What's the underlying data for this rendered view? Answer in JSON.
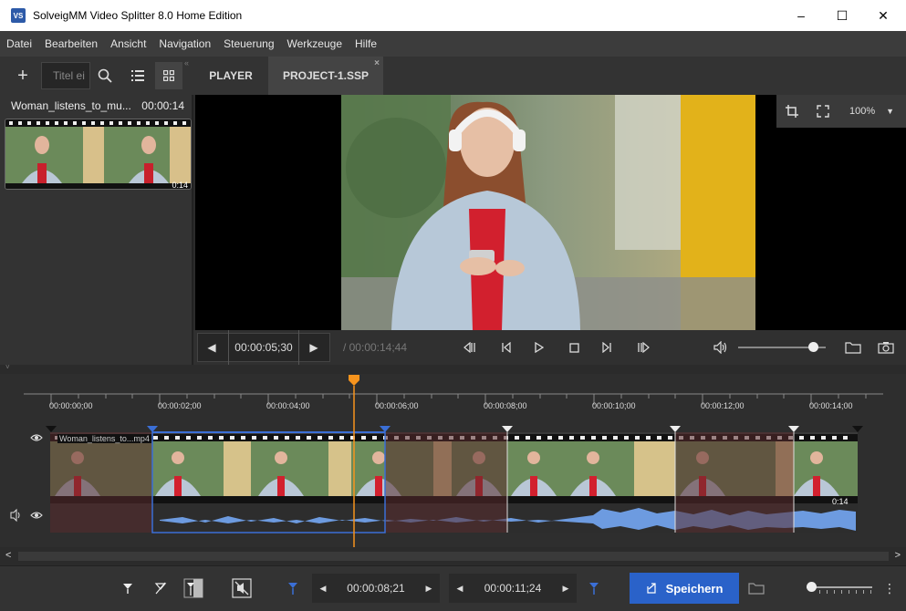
{
  "window": {
    "title": "SolveigMM Video Splitter 8.0 Home Edition",
    "icon_text": "VS",
    "minimize": "–",
    "maximize": "☐",
    "close": "✕"
  },
  "menu": [
    "Datei",
    "Bearbeiten",
    "Ansicht",
    "Navigation",
    "Steuerung",
    "Werkzeuge",
    "Hilfe"
  ],
  "left_toolbar": {
    "add": "+",
    "search_placeholder": "Titel ei"
  },
  "tabs": [
    {
      "label": "PLAYER"
    },
    {
      "label": "PROJECT-1.SSP",
      "close": "×"
    }
  ],
  "media": {
    "name": "Woman_listens_to_mu...",
    "duration": "00:00:14",
    "thumb_time": "0:14"
  },
  "zoom": {
    "value": "100%"
  },
  "transport": {
    "current": "00:00:05;30",
    "total": "/ 00:00:14;44",
    "volume": 0.85
  },
  "timeline": {
    "ticks": [
      "00:00:00;00",
      "00:00:02;00",
      "00:00:04;00",
      "00:00:06;00",
      "00:00:08;00",
      "00:00:10;00",
      "00:00:12;00",
      "00:00:14;00"
    ],
    "clip_label": "Woman_listens_to...mp4",
    "clip_end": "0:14"
  },
  "bottom": {
    "start_time": "00:00:08;21",
    "end_time": "00:00:11;24",
    "save_label": "Speichern",
    "scale_level": 0.0
  },
  "colors": {
    "accent": "#2a62c9",
    "playhead": "#f7941d",
    "marker_blue": "#3b6fd6",
    "waveform": "#6d9be0",
    "excluded": "#5a2b2e"
  }
}
